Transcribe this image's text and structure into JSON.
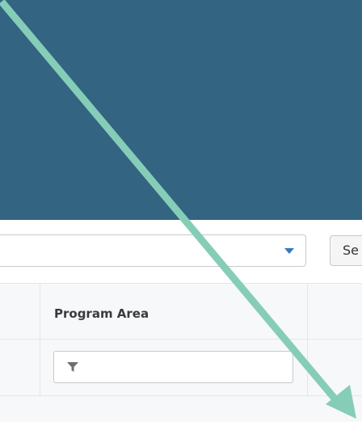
{
  "toolbar": {
    "search_button_label": "Se"
  },
  "grid": {
    "columns": [
      {
        "label": "Program Area"
      }
    ]
  },
  "icons": {
    "select_caret": "caret-down-icon",
    "filter": "funnel-icon"
  },
  "colors": {
    "banner": "#336482",
    "caret": "#2f7bc4",
    "arrow": "#86cdb8"
  }
}
